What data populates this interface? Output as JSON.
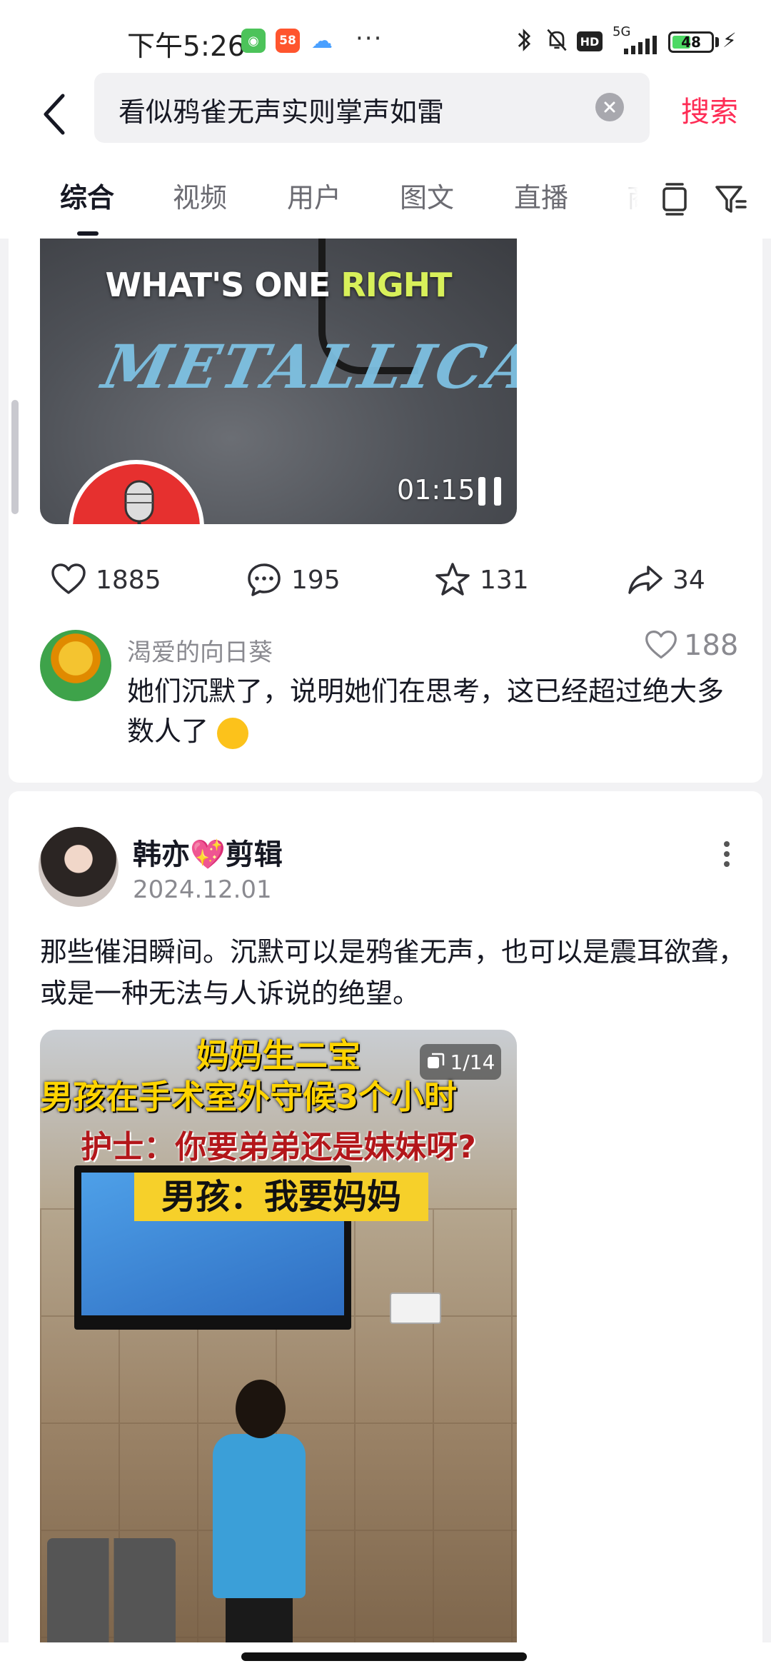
{
  "status_bar": {
    "time": "下午5:26",
    "app_icons": [
      {
        "name": "wechat-like-app-icon",
        "color": "#4cc35a"
      },
      {
        "name": "58-app-icon",
        "label": "58",
        "color": "#ff552e"
      },
      {
        "name": "cloud-app-icon",
        "color": "#4aa0ff"
      }
    ],
    "more_dots": "···",
    "hd_badge": "HD",
    "network": "5G",
    "battery_level": "48",
    "battery_fraction": 0.48
  },
  "search": {
    "query": "看似鸦雀无声实则掌声如雷",
    "button_label": "搜索",
    "accent_color": "#fe2c55"
  },
  "tabs": [
    {
      "label": "综合",
      "active": true
    },
    {
      "label": "视频",
      "active": false
    },
    {
      "label": "用户",
      "active": false
    },
    {
      "label": "图文",
      "active": false
    },
    {
      "label": "直播",
      "active": false
    },
    {
      "label": "商",
      "active": false
    }
  ],
  "video_post": {
    "caption_main": "WHAT'S ONE ",
    "caption_highlight": "RIGHT",
    "shirt_logo": "METALLICA",
    "duration": "01:15",
    "stats": {
      "likes": "1885",
      "comments": "195",
      "favorites": "131",
      "shares": "34"
    },
    "top_comment": {
      "author": "渴爱的向日葵",
      "text": "她们沉默了，说明她们在思考，这已经超过绝大多数人了",
      "likes": "188"
    }
  },
  "image_post": {
    "author": "韩亦💖剪辑",
    "date": "2024.12.01",
    "text": "那些催泪瞬间。沉默可以是鸦雀无声，也可以是震耳欲聋，或是一种无法与人诉说的绝望。",
    "image_counter": "1/14",
    "image_lines": [
      "妈妈生二宝",
      "男孩在手术室外守候3个小时",
      "护士：你要弟弟还是妹妹呀?",
      "男孩：我要妈妈"
    ]
  }
}
